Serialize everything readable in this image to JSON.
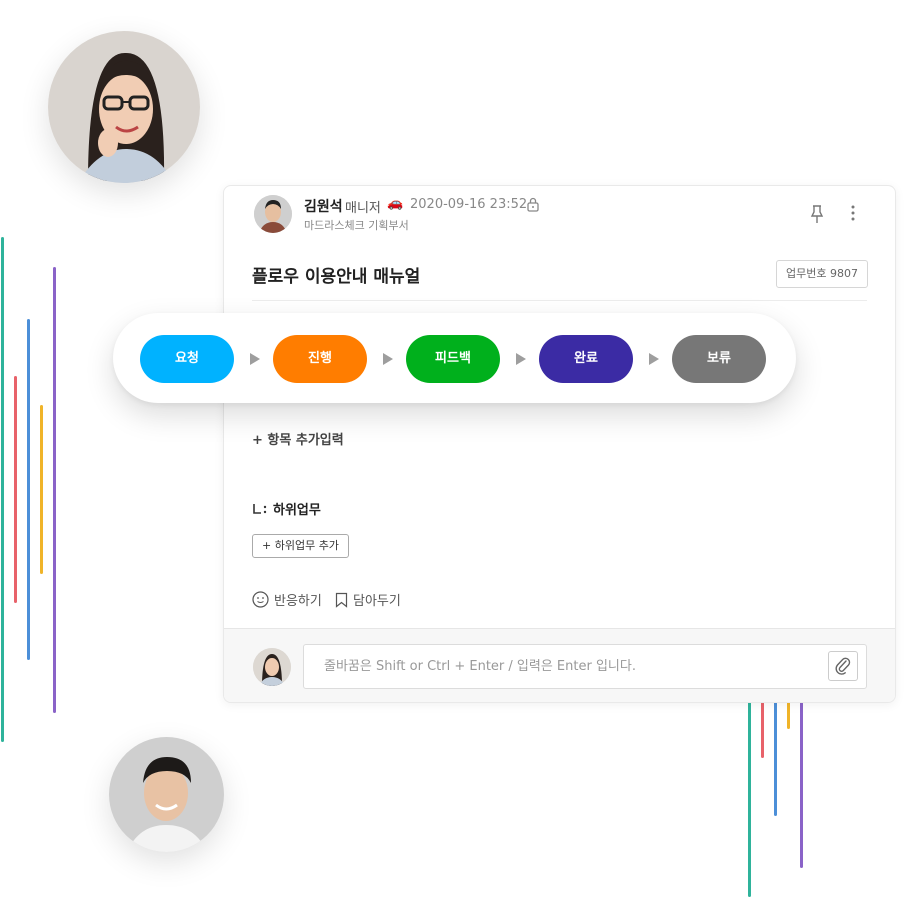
{
  "post": {
    "author_name": "김원석",
    "author_role": "매니저",
    "date": "2020-09-16 23:52",
    "department": "마드라스체크 기획부서",
    "title": "플로우 이용안내 매뉴얼",
    "task_number": "업무번호 9807"
  },
  "statuses": [
    {
      "label": "요청",
      "color": "#00b2ff"
    },
    {
      "label": "진행",
      "color": "#ff7d00"
    },
    {
      "label": "피드백",
      "color": "#00b01c"
    },
    {
      "label": "완료",
      "color": "#3b2ba4"
    },
    {
      "label": "보류",
      "color": "#777777"
    }
  ],
  "actions": {
    "add_item": "+ 항목 추가입력",
    "subtask_title": "하위업무",
    "subtask_add": "+ 하위업무 추가",
    "react": "반응하기",
    "save": "담아두기"
  },
  "comment": {
    "placeholder": "줄바꿈은 Shift or Ctrl + Enter / 입력은 Enter 입니다."
  },
  "decor_line_colors": [
    "#2fb39b",
    "#e8626a",
    "#4c8fd8",
    "#f0b429",
    "#8a63c8"
  ],
  "icons": [
    "car-icon",
    "lock-icon",
    "pin-icon",
    "more-icon",
    "subtask-icon",
    "smile-icon",
    "bookmark-icon",
    "paperclip-icon"
  ]
}
